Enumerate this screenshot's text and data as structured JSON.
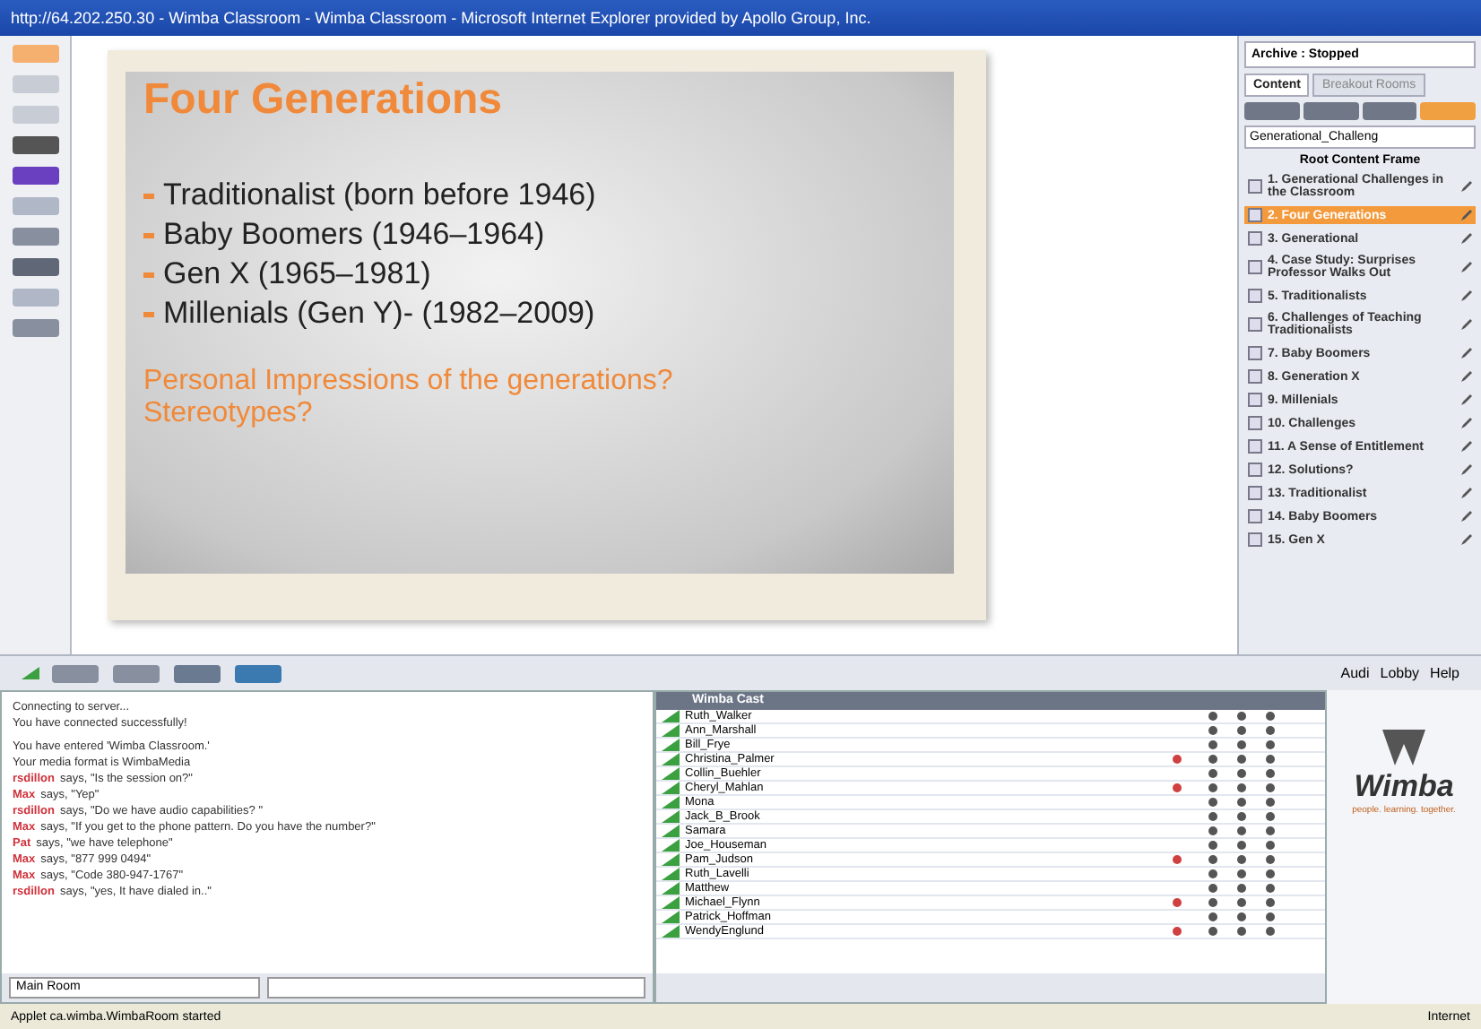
{
  "window": {
    "title": "http://64.202.250.30 - Wimba Classroom - Wimba Classroom - Microsoft Internet Explorer provided by Apollo Group, Inc."
  },
  "slide": {
    "title": "Four Generations",
    "bullets": [
      "Traditionalist (born before 1946)",
      "Baby Boomers (1946–1964)",
      "Gen X (1965–1981)",
      "Millenials (Gen Y)- (1982–2009)"
    ],
    "question": "Personal Impressions of the generations? Stereotypes?"
  },
  "content_panel": {
    "archive": "Archive : Stopped",
    "tabs": [
      {
        "label": "Content",
        "selected": true
      },
      {
        "label": "Breakout Rooms",
        "selected": false
      }
    ],
    "dropdown": "Generational_Challeng",
    "root": "Root Content Frame",
    "items": [
      {
        "label": "1. Generational Challenges in the Classroom",
        "selected": false
      },
      {
        "label": "2. Four Generations",
        "selected": true
      },
      {
        "label": "3. Generational",
        "selected": false
      },
      {
        "label": "4. Case Study: Surprises Professor Walks Out",
        "selected": false
      },
      {
        "label": "5. Traditionalists",
        "selected": false
      },
      {
        "label": "6. Challenges of Teaching Traditionalists",
        "selected": false
      },
      {
        "label": "7. Baby Boomers",
        "selected": false
      },
      {
        "label": "8. Generation X",
        "selected": false
      },
      {
        "label": "9. Millenials",
        "selected": false
      },
      {
        "label": "10. Challenges",
        "selected": false
      },
      {
        "label": "11. A Sense of Entitlement",
        "selected": false
      },
      {
        "label": "12. Solutions?",
        "selected": false
      },
      {
        "label": "13. Traditionalist",
        "selected": false
      },
      {
        "label": "14. Baby Boomers",
        "selected": false
      },
      {
        "label": "15. Gen X",
        "selected": false
      }
    ]
  },
  "chat": {
    "system": [
      "Connecting to server...",
      "You have connected successfully!",
      "You have entered 'Wimba Classroom.'",
      "Your media format is WimbaMedia"
    ],
    "messages": [
      {
        "name": "rsdillon",
        "text": "says, \"Is the session on?\""
      },
      {
        "name": "Max",
        "text": "says, \"Yep\""
      },
      {
        "name": "rsdillon",
        "text": "says, \"Do we have audio capabilities? \""
      },
      {
        "name": "Max",
        "text": "says, \"If you get to the phone pattern. Do you have the number?\""
      },
      {
        "name": "Pat",
        "text": "says, \"we have telephone\""
      },
      {
        "name": "Max",
        "text": "says, \"877 999 0494\""
      },
      {
        "name": "Max",
        "text": "says, \"Code 380-947-1767\""
      },
      {
        "name": "rsdillon",
        "text": "says, \"yes, It have dialed in..\""
      }
    ],
    "room": "Main Room"
  },
  "participants": {
    "header": "Wimba Cast",
    "rows": [
      {
        "name": "Ruth_Walker",
        "hand": false
      },
      {
        "name": "Ann_Marshall",
        "hand": false
      },
      {
        "name": "Bill_Frye",
        "hand": false
      },
      {
        "name": "Christina_Palmer",
        "hand": true
      },
      {
        "name": "Collin_Buehler",
        "hand": false
      },
      {
        "name": "Cheryl_Mahlan",
        "hand": true
      },
      {
        "name": "Mona",
        "hand": false
      },
      {
        "name": "Jack_B_Brook",
        "hand": false
      },
      {
        "name": "Samara",
        "hand": false
      },
      {
        "name": "Joe_Houseman",
        "hand": false
      },
      {
        "name": "Pam_Judson",
        "hand": true
      },
      {
        "name": "Ruth_Lavelli",
        "hand": false
      },
      {
        "name": "Matthew",
        "hand": false
      },
      {
        "name": "Michael_Flynn",
        "hand": true
      },
      {
        "name": "Patrick_Hoffman",
        "hand": false
      },
      {
        "name": "WendyEnglund",
        "hand": true
      }
    ]
  },
  "links": [
    "Audi",
    "Lobby",
    "Help"
  ],
  "logo": {
    "name": "Wimba",
    "tagline": "people. learning. together."
  },
  "status_bar": {
    "text": "Applet ca.wimba.WimbaRoom started",
    "zone": "Internet"
  }
}
